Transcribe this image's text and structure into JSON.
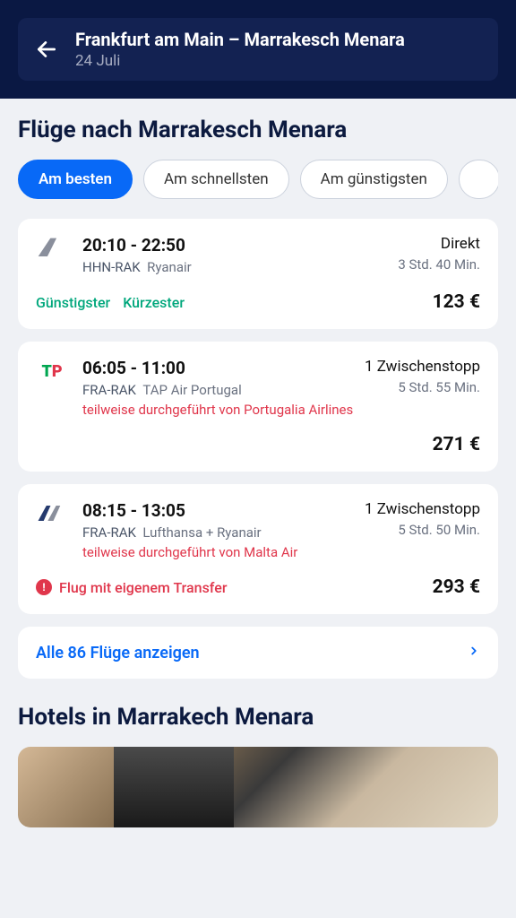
{
  "header": {
    "route": "Frankfurt am Main – Marrakesch Menara",
    "date": "24 Juli"
  },
  "page_title": "Flüge nach Marrakesch Menara",
  "filters": [
    {
      "label": "Am besten",
      "active": true
    },
    {
      "label": "Am schnellsten",
      "active": false
    },
    {
      "label": "Am günstigsten",
      "active": false
    }
  ],
  "flights": [
    {
      "times": "20:10 - 22:50",
      "codes": "HHN-RAK",
      "airline": "Ryanair",
      "stops": "Direkt",
      "duration": "3 Std. 40 Min.",
      "tags": [
        "Günstigster",
        "Kürzester"
      ],
      "price": "123 €"
    },
    {
      "times": "06:05 - 11:00",
      "codes": "FRA-RAK",
      "airline": "TAP Air Portugal",
      "operated": "teilweise durchgeführt von Portugalia Airlines",
      "stops": "1 Zwischenstopp",
      "duration": "5 Std. 55 Min.",
      "price": "271 €"
    },
    {
      "times": "08:15 - 13:05",
      "codes": "FRA-RAK",
      "airline": "Lufthansa + Ryanair",
      "operated": "teilweise durchgeführt von Malta Air",
      "stops": "1 Zwischenstopp",
      "duration": "5 Std. 50 Min.",
      "transfer_warning": "Flug mit eigenem Transfer",
      "price": "293 €"
    }
  ],
  "show_all": "Alle 86 Flüge anzeigen",
  "hotels_title": "Hotels in Marrakech Menara"
}
